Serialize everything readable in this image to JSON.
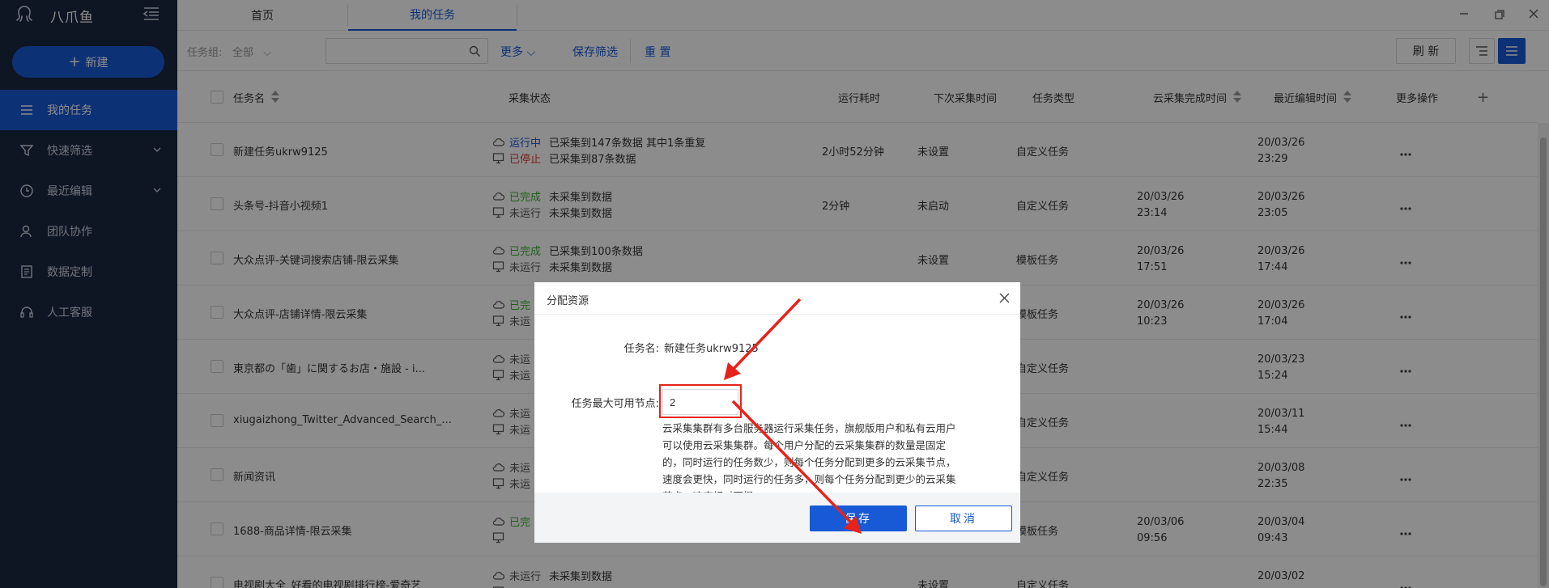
{
  "app": {
    "brand": "八爪鱼"
  },
  "sidebar": {
    "new_button": "新建",
    "items": [
      {
        "label": "我的任务",
        "icon": "list-icon",
        "active": true
      },
      {
        "label": "快速筛选",
        "icon": "filter-icon",
        "expandable": true
      },
      {
        "label": "最近编辑",
        "icon": "clock-icon",
        "expandable": true
      },
      {
        "label": "团队协作",
        "icon": "team-icon"
      },
      {
        "label": "数据定制",
        "icon": "doc-icon"
      },
      {
        "label": "人工客服",
        "icon": "headset-icon"
      }
    ]
  },
  "tabs": [
    {
      "label": "首页"
    },
    {
      "label": "我的任务"
    }
  ],
  "toolbar": {
    "group_label": "任务组:",
    "group_value": "全部",
    "search_placeholder": "",
    "more": "更多",
    "save_filter": "保存筛选",
    "reset": "重 置",
    "refresh": "刷 新"
  },
  "table": {
    "columns": [
      "任务名",
      "采集状态",
      "运行耗时",
      "下次采集时间",
      "任务类型",
      "云采集完成时间",
      "最近编辑时间",
      "更多操作"
    ],
    "add_col": "+",
    "rows": [
      {
        "name": "新建任务ukrw9125",
        "cloud_label": "运行中",
        "cloud_cls": "running",
        "cloud_text": "已采集到147条数据 其中1条重复",
        "local_label": "已停止",
        "local_cls": "stopped",
        "local_text": "已采集到87条数据",
        "duration": "2小时52分钟",
        "next": "未设置",
        "type": "自定义任务",
        "cloud_d": "",
        "cloud_t": "",
        "edit_d": "20/03/26",
        "edit_t": "23:29"
      },
      {
        "name": "头条号-抖音小视频1",
        "cloud_label": "已完成",
        "cloud_cls": "done",
        "cloud_text": "未采集到数据",
        "local_label": "未运行",
        "local_cls": "idle",
        "local_text": "未采集到数据",
        "duration": "2分钟",
        "next": "未启动",
        "type": "自定义任务",
        "cloud_d": "20/03/26",
        "cloud_t": "23:14",
        "edit_d": "20/03/26",
        "edit_t": "23:05"
      },
      {
        "name": "大众点评-关键词搜索店铺-限云采集",
        "cloud_label": "已完成",
        "cloud_cls": "done",
        "cloud_text": "已采集到100条数据",
        "local_label": "未运行",
        "local_cls": "idle",
        "local_text": "未采集到数据",
        "duration": "",
        "next": "未设置",
        "type": "模板任务",
        "cloud_d": "20/03/26",
        "cloud_t": "17:51",
        "edit_d": "20/03/26",
        "edit_t": "17:44"
      },
      {
        "name": "大众点评-店铺详情-限云采集",
        "cloud_label": "已完",
        "cloud_cls": "done",
        "cloud_text": "",
        "local_label": "未运",
        "local_cls": "idle",
        "local_text": "",
        "duration": "",
        "next": "",
        "type": "模板任务",
        "cloud_d": "20/03/26",
        "cloud_t": "10:23",
        "edit_d": "20/03/26",
        "edit_t": "17:04"
      },
      {
        "name": "東京都の「歯」に関するお店・施設 - i...",
        "cloud_label": "未运",
        "cloud_cls": "idle",
        "cloud_text": "",
        "local_label": "未运",
        "local_cls": "idle",
        "local_text": "",
        "duration": "",
        "next": "",
        "type": "自定义任务",
        "cloud_d": "",
        "cloud_t": "",
        "edit_d": "20/03/23",
        "edit_t": "15:24"
      },
      {
        "name": "xiugaizhong_Twitter_Advanced_Search_...",
        "cloud_label": "未运",
        "cloud_cls": "idle",
        "cloud_text": "",
        "local_label": "未运",
        "local_cls": "idle",
        "local_text": "",
        "duration": "",
        "next": "",
        "type": "自定义任务",
        "cloud_d": "",
        "cloud_t": "",
        "edit_d": "20/03/11",
        "edit_t": "15:44"
      },
      {
        "name": "新闻资讯",
        "cloud_label": "未运",
        "cloud_cls": "idle",
        "cloud_text": "",
        "local_label": "未运",
        "local_cls": "idle",
        "local_text": "",
        "duration": "",
        "next": "",
        "type": "自定义任务",
        "cloud_d": "",
        "cloud_t": "",
        "edit_d": "20/03/08",
        "edit_t": "22:35"
      },
      {
        "name": "1688-商品详情-限云采集",
        "cloud_label": "已完",
        "cloud_cls": "done",
        "cloud_text": "",
        "local_label": "",
        "local_cls": "idle",
        "local_text": "",
        "duration": "",
        "next": "",
        "type": "模板任务",
        "cloud_d": "20/03/06",
        "cloud_t": "09:56",
        "edit_d": "20/03/04",
        "edit_t": "09:43"
      },
      {
        "name": "电视剧大全_好看的电视剧排行榜-爱奇艺",
        "cloud_label": "未运行",
        "cloud_cls": "idle",
        "cloud_text": "未采集到数据",
        "local_label": "",
        "local_cls": "idle",
        "local_text": "",
        "duration": "",
        "next": "未设置",
        "type": "自定义任务",
        "cloud_d": "",
        "cloud_t": "",
        "edit_d": "20/03/02",
        "edit_t": ""
      }
    ]
  },
  "dialog": {
    "title": "分配资源",
    "task_name_label": "任务名:",
    "task_name_value": "新建任务ukrw9125",
    "max_nodes_label": "任务最大可用节点:",
    "max_nodes_value": "2",
    "description": "云采集集群有多台服务器运行采集任务，旗舰版用户和私有云用户可以使用云采集集群。每个用户分配的云采集集群的数量是固定的，同时运行的任务数少，则每个任务分配到更多的云采集节点，速度会更快，同时运行的任务多，则每个任务分配到更少的云采集节点，速度相对更慢。",
    "save": "保存",
    "cancel": "取消"
  },
  "annotation": {
    "color": "#e6231b"
  }
}
